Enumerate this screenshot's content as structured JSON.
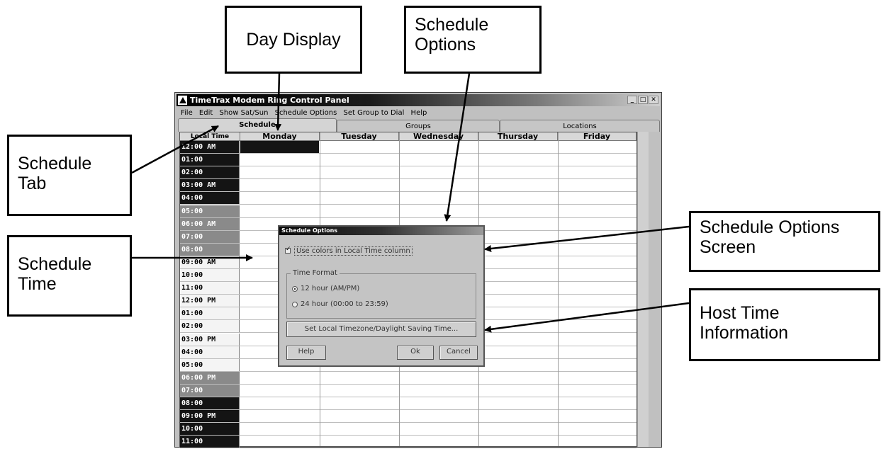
{
  "callouts": {
    "day_display": "Day Display",
    "schedule_options": "Schedule\nOptions",
    "schedule_tab": "Schedule\nTab",
    "schedule_time": "Schedule\nTime",
    "schedule_options_screen": "Schedule Options\nScreen",
    "host_time_info": "Host Time\nInformation"
  },
  "window": {
    "title": "TimeTrax Modem R",
    "title_rest": "ing Control Panel",
    "menu": [
      "File",
      "Edit",
      "Show Sat/Sun",
      "Schedule Options",
      "Set Group to Dial",
      "Help"
    ],
    "tabs": [
      "Schedule",
      "Groups",
      "Locations"
    ],
    "columns": [
      "Local Time",
      "Monday",
      "Tuesday",
      "Wednesday",
      "Thursday",
      "Friday"
    ],
    "times": [
      {
        "label": "12:00 AM",
        "shade": "dark"
      },
      {
        "label": "01:00",
        "shade": "dark"
      },
      {
        "label": "02:00",
        "shade": "dark"
      },
      {
        "label": "03:00 AM",
        "shade": "dark"
      },
      {
        "label": "04:00",
        "shade": "dark"
      },
      {
        "label": "05:00",
        "shade": "mid"
      },
      {
        "label": "06:00 AM",
        "shade": "mid"
      },
      {
        "label": "07:00",
        "shade": "mid"
      },
      {
        "label": "08:00",
        "shade": "mid"
      },
      {
        "label": "09:00 AM",
        "shade": "light"
      },
      {
        "label": "10:00",
        "shade": "light"
      },
      {
        "label": "11:00",
        "shade": "light"
      },
      {
        "label": "12:00 PM",
        "shade": "light"
      },
      {
        "label": "01:00",
        "shade": "light"
      },
      {
        "label": "02:00",
        "shade": "light"
      },
      {
        "label": "03:00 PM",
        "shade": "light"
      },
      {
        "label": "04:00",
        "shade": "light"
      },
      {
        "label": "05:00",
        "shade": "light"
      },
      {
        "label": "06:00 PM",
        "shade": "mid"
      },
      {
        "label": "07:00",
        "shade": "mid"
      },
      {
        "label": "08:00",
        "shade": "dark"
      },
      {
        "label": "09:00 PM",
        "shade": "dark"
      },
      {
        "label": "10:00",
        "shade": "dark"
      },
      {
        "label": "11:00",
        "shade": "dark"
      }
    ]
  },
  "dialog": {
    "title": "Schedule Options",
    "use_colors_label": "Use colors in Local Time column",
    "use_colors_checked": true,
    "time_format_label": "Time Format",
    "format_12": "12 hour (AM/PM)",
    "format_24": "24 hour (00:00 to 23:59)",
    "selected_format": "12 hour",
    "timezone_button": "Set Local Timezone/Daylight Saving Time...",
    "help_button": "Help",
    "ok_button": "Ok",
    "cancel_button": "Cancel"
  }
}
